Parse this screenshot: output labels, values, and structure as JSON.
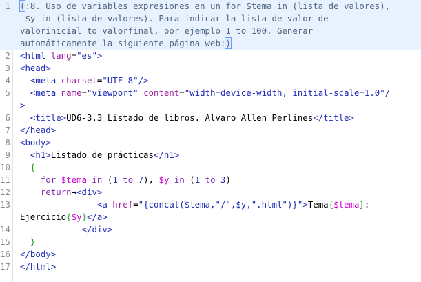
{
  "lines": [
    {
      "n": "1",
      "parts": [
        [
          "bracket",
          "("
        ],
        [
          "com",
          ":8. Uso de variables expresiones en un for $tema in (lista de valores),"
        ]
      ]
    },
    {
      "n": "",
      "parts": [
        [
          "com",
          " $y in (lista de valores). Para indicar la lista de valor de"
        ]
      ]
    },
    {
      "n": "",
      "parts": [
        [
          "com",
          "valorinicial to valorfinal, por ejemplo 1 to 100. Generar"
        ]
      ]
    },
    {
      "n": "",
      "parts": [
        [
          "com",
          "automáticamente la siguiente página web:"
        ],
        [
          "bracket",
          ")"
        ]
      ]
    },
    {
      "n": "2",
      "parts": [
        [
          "tag",
          "<html "
        ],
        [
          "attr",
          "lang"
        ],
        [
          "text",
          "="
        ],
        [
          "val",
          "\"es\""
        ],
        [
          "tag",
          ">"
        ]
      ]
    },
    {
      "n": "3",
      "parts": [
        [
          "tag",
          "<head>"
        ]
      ]
    },
    {
      "n": "4",
      "parts": [
        [
          "text",
          "  "
        ],
        [
          "tag",
          "<meta "
        ],
        [
          "attr",
          "charset"
        ],
        [
          "text",
          "="
        ],
        [
          "val",
          "\"UTF-8\""
        ],
        [
          "tag",
          "/>"
        ]
      ]
    },
    {
      "n": "5",
      "parts": [
        [
          "text",
          "  "
        ],
        [
          "tag",
          "<meta "
        ],
        [
          "attr",
          "name"
        ],
        [
          "text",
          "="
        ],
        [
          "val",
          "\"viewport\" "
        ],
        [
          "attr",
          "content"
        ],
        [
          "text",
          "="
        ],
        [
          "val",
          "\"width=device-width, initial-scale=1.0\""
        ],
        [
          "tag",
          "/"
        ]
      ]
    },
    {
      "n": "",
      "parts": [
        [
          "tag",
          ">"
        ]
      ]
    },
    {
      "n": "6",
      "parts": [
        [
          "text",
          "  "
        ],
        [
          "tag",
          "<title>"
        ],
        [
          "text",
          "UD6-3.3 Listado de libros. Alvaro Allen Perlines"
        ],
        [
          "tag",
          "</title>"
        ]
      ]
    },
    {
      "n": "7",
      "parts": [
        [
          "tag",
          "</head>"
        ]
      ]
    },
    {
      "n": "8",
      "parts": [
        [
          "tag",
          "<body>"
        ]
      ]
    },
    {
      "n": "9",
      "parts": [
        [
          "text",
          "  "
        ],
        [
          "tag",
          "<h1>"
        ],
        [
          "text",
          "Listado de prácticas"
        ],
        [
          "tag",
          "</h1>"
        ]
      ]
    },
    {
      "n": "10",
      "parts": [
        [
          "text",
          "  "
        ],
        [
          "brace",
          "{"
        ]
      ]
    },
    {
      "n": "11",
      "parts": [
        [
          "text",
          "    "
        ],
        [
          "kw",
          "for "
        ],
        [
          "var",
          "$tema "
        ],
        [
          "kw",
          "in "
        ],
        [
          "text",
          "("
        ],
        [
          "num",
          "1 "
        ],
        [
          "kw",
          "to "
        ],
        [
          "num",
          "7"
        ],
        [
          "text",
          "), "
        ],
        [
          "var",
          "$y "
        ],
        [
          "kw",
          "in "
        ],
        [
          "text",
          "("
        ],
        [
          "num",
          "1 "
        ],
        [
          "kw",
          "to "
        ],
        [
          "num",
          "3"
        ],
        [
          "text",
          ")"
        ]
      ]
    },
    {
      "n": "12",
      "parts": [
        [
          "text",
          "    "
        ],
        [
          "kw",
          "return"
        ],
        [
          "text",
          "→"
        ],
        [
          "tag",
          "<div>"
        ]
      ]
    },
    {
      "n": "13",
      "parts": [
        [
          "text",
          "               "
        ],
        [
          "tag",
          "<a "
        ],
        [
          "attr",
          "href"
        ],
        [
          "text",
          "="
        ],
        [
          "val",
          "\"{concat($tema,\"/\",$y,\".html\")}\""
        ],
        [
          "tag",
          ">"
        ],
        [
          "text",
          "Tema"
        ],
        [
          "brace",
          "{"
        ],
        [
          "var",
          "$tema"
        ],
        [
          "brace",
          "}"
        ],
        [
          "text",
          ":"
        ]
      ]
    },
    {
      "n": "",
      "parts": [
        [
          "text",
          "Ejercicio"
        ],
        [
          "brace",
          "{"
        ],
        [
          "var",
          "$y"
        ],
        [
          "brace",
          "}"
        ],
        [
          "tag",
          "</a>"
        ]
      ]
    },
    {
      "n": "14",
      "parts": [
        [
          "text",
          "            "
        ],
        [
          "tag",
          "</div>"
        ]
      ]
    },
    {
      "n": "15",
      "parts": [
        [
          "text",
          "  "
        ],
        [
          "brace",
          "}"
        ]
      ]
    },
    {
      "n": "16",
      "parts": [
        [
          "tag",
          "</body>"
        ]
      ]
    },
    {
      "n": "17",
      "parts": [
        [
          "tag",
          "</html>"
        ]
      ]
    }
  ]
}
